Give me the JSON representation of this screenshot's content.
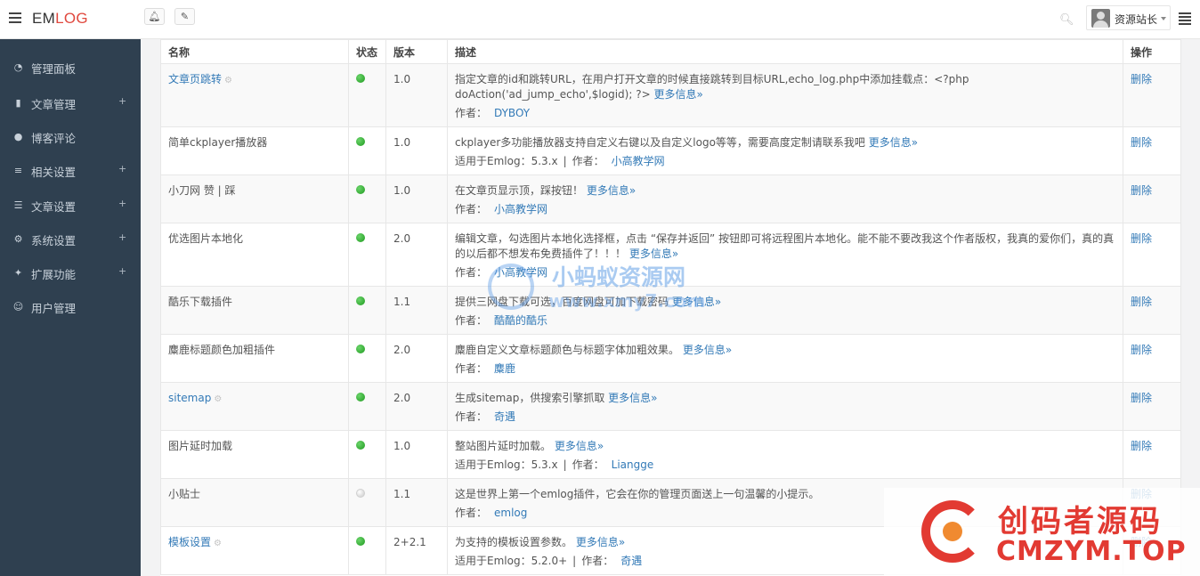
{
  "brand": {
    "logo_main": "EM",
    "logo_accent": "LOG"
  },
  "topbar": {
    "user_name": "资源站长"
  },
  "sidebar": {
    "items": [
      {
        "label": "管理面板",
        "icon": "dashboard-icon",
        "expandable": false
      },
      {
        "label": "文章管理",
        "icon": "bookmark-icon",
        "expandable": true
      },
      {
        "label": "博客评论",
        "icon": "comments-icon",
        "expandable": false
      },
      {
        "label": "相关设置",
        "icon": "sliders-icon",
        "expandable": true
      },
      {
        "label": "文章设置",
        "icon": "list-icon",
        "expandable": true
      },
      {
        "label": "系统设置",
        "icon": "gear-icon",
        "expandable": true
      },
      {
        "label": "扩展功能",
        "icon": "puzzle-icon",
        "expandable": true
      },
      {
        "label": "用户管理",
        "icon": "users-icon",
        "expandable": false
      }
    ],
    "expand_symbol": "+"
  },
  "table": {
    "headers": [
      "名称",
      "状态",
      "版本",
      "描述",
      "操作"
    ],
    "rows": [
      {
        "name": "文章页跳转",
        "linked": true,
        "gear": true,
        "status": "on",
        "version": "1.0",
        "desc": "指定文章的id和跳转URL，在用户打开文章的时候直接跳转到目标URL,echo_log.php中添加挂载点：<?php doAction('ad_jump_echo',$logid); ?>",
        "more": "更多信息»",
        "emlog": "",
        "author_label": "作者：",
        "author": "DYBOY",
        "action": "删除"
      },
      {
        "name": "简单ckplayer播放器",
        "linked": false,
        "gear": false,
        "status": "on",
        "version": "1.0",
        "desc": "ckplayer多功能播放器支持自定义右键以及自定义logo等等，需要高度定制请联系我吧",
        "more": "更多信息»",
        "emlog": "适用于Emlog：5.3.x",
        "author_label": "作者：",
        "author": "小高教学网",
        "action": "删除"
      },
      {
        "name": "小刀网 赞 | 踩",
        "linked": false,
        "gear": false,
        "status": "on",
        "version": "1.0",
        "desc": "在文章页显示顶，踩按钮！",
        "more": "更多信息»",
        "emlog": "",
        "author_label": "作者：",
        "author": "小高教学网",
        "action": "删除"
      },
      {
        "name": "优选图片本地化",
        "linked": false,
        "gear": false,
        "status": "on",
        "version": "2.0",
        "desc": "编辑文章，勾选图片本地化选择框，点击 “保存并返回” 按钮即可将远程图片本地化。能不能不要改我这个作者版权，我真的爱你们，真的真的以后都不想发布免费插件了！！！",
        "more": "更多信息»",
        "emlog": "",
        "author_label": "作者：",
        "author": "小高教学网",
        "action": "删除"
      },
      {
        "name": "酷乐下载插件",
        "linked": false,
        "gear": false,
        "status": "on",
        "version": "1.1",
        "desc": "提供三网盘下载可选，百度网盘可加下载密码",
        "more": "更多信息»",
        "emlog": "",
        "author_label": "作者：",
        "author": "酷酷的酷乐",
        "action": "删除"
      },
      {
        "name": "麋鹿标题颜色加粗插件",
        "linked": false,
        "gear": false,
        "status": "on",
        "version": "2.0",
        "desc": "麋鹿自定义文章标题颜色与标题字体加粗效果。",
        "more": "更多信息»",
        "emlog": "",
        "author_label": "作者：",
        "author": "麋鹿",
        "action": "删除"
      },
      {
        "name": "sitemap",
        "linked": true,
        "gear": true,
        "status": "on",
        "version": "2.0",
        "desc": "生成sitemap，供搜索引擎抓取",
        "more": "更多信息»",
        "emlog": "",
        "author_label": "作者：",
        "author": "奇遇",
        "action": "删除"
      },
      {
        "name": "图片延时加载",
        "linked": false,
        "gear": false,
        "status": "on",
        "version": "1.0",
        "desc": "整站图片延时加载。",
        "more": "更多信息»",
        "emlog": "适用于Emlog：5.3.x",
        "author_label": "作者：",
        "author": "Liangge",
        "action": "删除"
      },
      {
        "name": "小贴士",
        "linked": false,
        "gear": false,
        "status": "off",
        "version": "1.1",
        "desc": "这是世界上第一个emlog插件，它会在你的管理页面送上一句温馨的小提示。",
        "more": "",
        "emlog": "",
        "author_label": "作者：",
        "author": "emlog",
        "action": "删除"
      },
      {
        "name": "模板设置",
        "linked": true,
        "gear": true,
        "status": "on",
        "version": "2+2.1",
        "desc": "为支持的模板设置参数。",
        "more": "更多信息»",
        "emlog": "适用于Emlog：5.2.0+",
        "author_label": "作者：",
        "author": "奇遇",
        "action": "删除"
      }
    ]
  },
  "watermarks": {
    "center_title": "小蚂蚁资源网",
    "center_url": "www.xmy7.com",
    "corner_title": "创码者源码",
    "corner_url": "CMZYM.TOP"
  }
}
